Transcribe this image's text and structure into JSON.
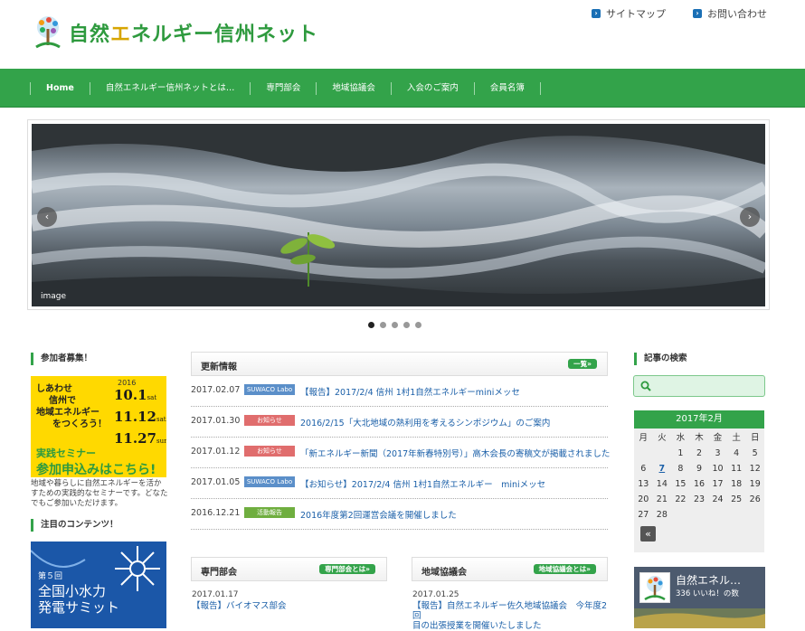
{
  "header": {
    "logo_text_1": "自然",
    "logo_text_2": "エ",
    "logo_text_3": "ネルギー信州",
    "logo_text_4": "ネット",
    "sitemap": "サイトマップ",
    "contact": "お問い合わせ"
  },
  "nav": {
    "items": [
      "Home",
      "自然エネルギー信州ネットとは…",
      "専門部会",
      "地域協議会",
      "入会のご案内",
      "会員名簿"
    ]
  },
  "slider": {
    "caption": "image",
    "prev": "‹",
    "next": "›",
    "active_dot": 1,
    "dot_count": 5
  },
  "left": {
    "recruit_heading": "参加者募集！",
    "banner1": {
      "line1": "しあわせ",
      "line2": "信州で",
      "line3": "地域エネルギー",
      "line4": "をつくろう！",
      "year": "2016",
      "dates": [
        {
          "date": "10.1",
          "day": "sat"
        },
        {
          "date": "11.12",
          "day": "sat"
        },
        {
          "date": "11.27",
          "day": "sun"
        }
      ],
      "seminar": "実践セミナー",
      "apply": "参加申込みはこちら!"
    },
    "description": "地域や暮らしに自然エネルギーを活かすための実践的なセミナーです。どなたでもご参加いただけます。",
    "featured_heading": "注目のコンテンツ！",
    "banner2": {
      "small": "第５回",
      "big1": "全国小水力",
      "big2": "発電サミット"
    }
  },
  "news": {
    "title": "更新情報",
    "more": "一覧»",
    "rows": [
      {
        "date": "2017.02.07",
        "cat": "SUWACO Labo",
        "cat_color": "#5b8fc9",
        "text": "【報告】2017/2/4 信州 1村1自然エネルギーminiメッセ"
      },
      {
        "date": "2017.01.30",
        "cat": "お知らせ",
        "cat_color": "#e06d6d",
        "text": "2016/2/15「大北地域の熱利用を考えるシンポジウム」のご案内"
      },
      {
        "date": "2017.01.12",
        "cat": "お知らせ",
        "cat_color": "#e06d6d",
        "text": "「新エネルギー新聞（2017年新春特別号）」高木会長の寄稿文が掲載されました"
      },
      {
        "date": "2017.01.05",
        "cat": "SUWACO Labo",
        "cat_color": "#5b8fc9",
        "text": "【お知らせ】2017/2/4 信州 1村1自然エネルギー　miniメッセ"
      },
      {
        "date": "2016.12.21",
        "cat": "活動報告",
        "cat_color": "#6fae3f",
        "text": "2016年度第2回運営会議を開催しました"
      }
    ]
  },
  "senmon": {
    "title": "専門部会",
    "more": "専門部会とは»",
    "date": "2017.01.17",
    "text": "【報告】バイオマス部会"
  },
  "chiiki": {
    "title": "地域協議会",
    "more": "地域協議会とは»",
    "date": "2017.01.25",
    "text1": "【報告】自然エネルギー佐久地域協議会　今年度2回",
    "text2": "目の出張授業を開催いたしました"
  },
  "right": {
    "search_heading": "記事の検索",
    "calendar": {
      "title": "2017年2月",
      "weekdays": [
        "月",
        "火",
        "水",
        "木",
        "金",
        "土",
        "日"
      ],
      "cells": [
        "",
        "",
        "1",
        "2",
        "3",
        "4",
        "5",
        "6",
        "7",
        "8",
        "9",
        "10",
        "11",
        "12",
        "13",
        "14",
        "15",
        "16",
        "17",
        "18",
        "19",
        "20",
        "21",
        "22",
        "23",
        "24",
        "25",
        "26",
        "27",
        "28",
        "",
        "",
        "",
        "",
        ""
      ],
      "linked_day": "7",
      "prev": "«"
    },
    "facebook": {
      "name": "自然エネル…",
      "likes": "336 いいね！の数"
    }
  }
}
